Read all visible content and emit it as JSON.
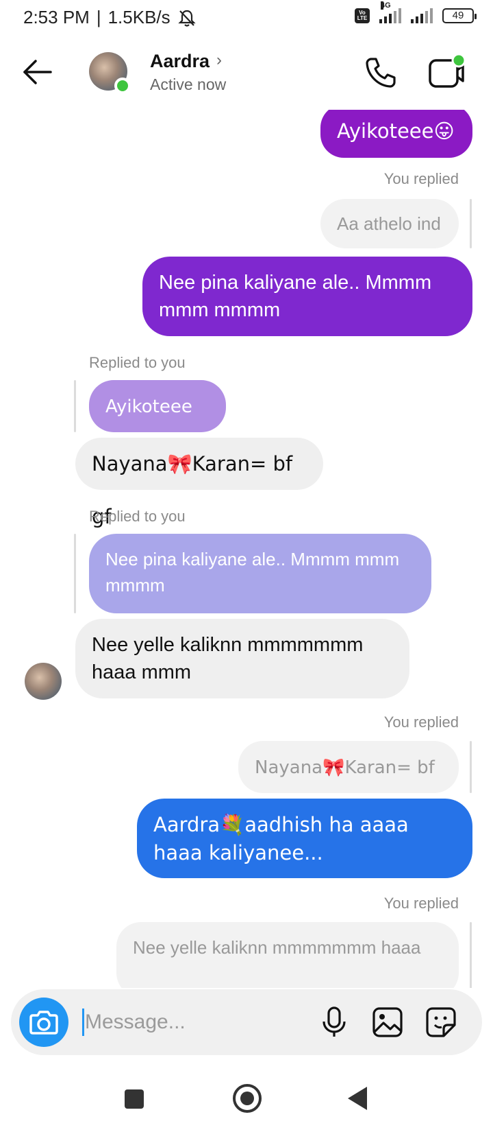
{
  "status_bar": {
    "time": "2:53 PM",
    "speed": "1.5KB/s",
    "network": "4G",
    "volte": "Vo LTE",
    "battery": "49"
  },
  "header": {
    "contact_name": "Aardra",
    "chevron": "›",
    "status": "Active now",
    "online_color": "#3ec53e"
  },
  "messages": {
    "m1": {
      "text": "Ayikoteee😛",
      "direction": "outgoing"
    },
    "r1_meta": "You replied",
    "r1_quote": "Aa athelo ind",
    "m2": {
      "text": "Nee pina kaliyane ale.. Mmmm mmm mmmm",
      "direction": "outgoing"
    },
    "r2_meta": "Replied to you",
    "r2_quote": "Ayikoteee😛",
    "m3": {
      "text": "Nayana🎀Karan= bf gf",
      "direction": "incoming"
    },
    "r3_meta": "Replied to you",
    "r3_quote": "Nee pina kaliyane ale.. Mmmm mmm mmmm",
    "m4": {
      "text": "Nee yelle kaliknn mmmmmmm haaa mmm",
      "direction": "incoming"
    },
    "r4_meta": "You replied",
    "r4_quote": "Nayana🎀Karan= bf gf",
    "m5": {
      "text": "Aardra💐aadhish ha aaaa haaa kaliyanee...",
      "direction": "outgoing"
    },
    "r5_meta": "You replied",
    "r5_quote": "Nee yelle kaliknn mmmmmmm haaa"
  },
  "composer": {
    "placeholder": "Message..."
  },
  "colors": {
    "outgoing_purple": "#8b1ac4",
    "outgoing_violet": "#7f28cf",
    "outgoing_blue": "#2673e8",
    "incoming_grey": "#efefef",
    "camera_blue": "#2196f3"
  },
  "icons": [
    "back-arrow-icon",
    "phone-icon",
    "video-icon",
    "camera-icon",
    "mic-icon",
    "gallery-icon",
    "sticker-icon",
    "nav-recents-icon",
    "nav-home-icon",
    "nav-back-icon",
    "bell-off-icon"
  ]
}
